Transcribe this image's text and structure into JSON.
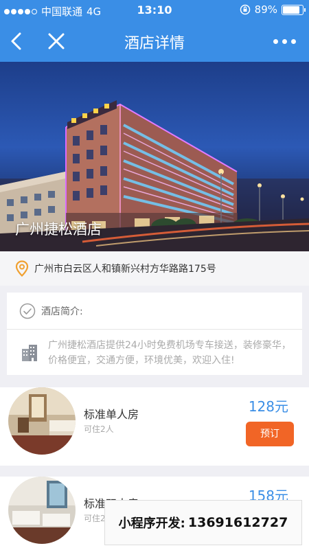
{
  "status_bar": {
    "carrier": "中国联通",
    "network": "4G",
    "time": "13:10",
    "battery": "89%",
    "battery_level": 0.89
  },
  "nav": {
    "title": "酒店详情"
  },
  "hotel": {
    "name": "广州捷松酒店",
    "address": "广州市白云区人和镇新兴村方华路路175号",
    "intro_label": "酒店简介:",
    "description": "广州捷松酒店提供24小时免费机场专车接送，装修豪华，价格便宜，交通方便，环境优美，欢迎入住!"
  },
  "rooms": [
    {
      "name": "标准单人房",
      "capacity": "可住2人",
      "price": "128元",
      "book_label": "预订"
    },
    {
      "name": "标准双人房",
      "capacity": "可住2人",
      "price": "158元"
    }
  ],
  "promo": {
    "label": "小程序开发:",
    "phone": "13691612727"
  },
  "colors": {
    "primary": "#3a8ee6",
    "book_button": "#f16526",
    "pin": "#f0a030"
  }
}
